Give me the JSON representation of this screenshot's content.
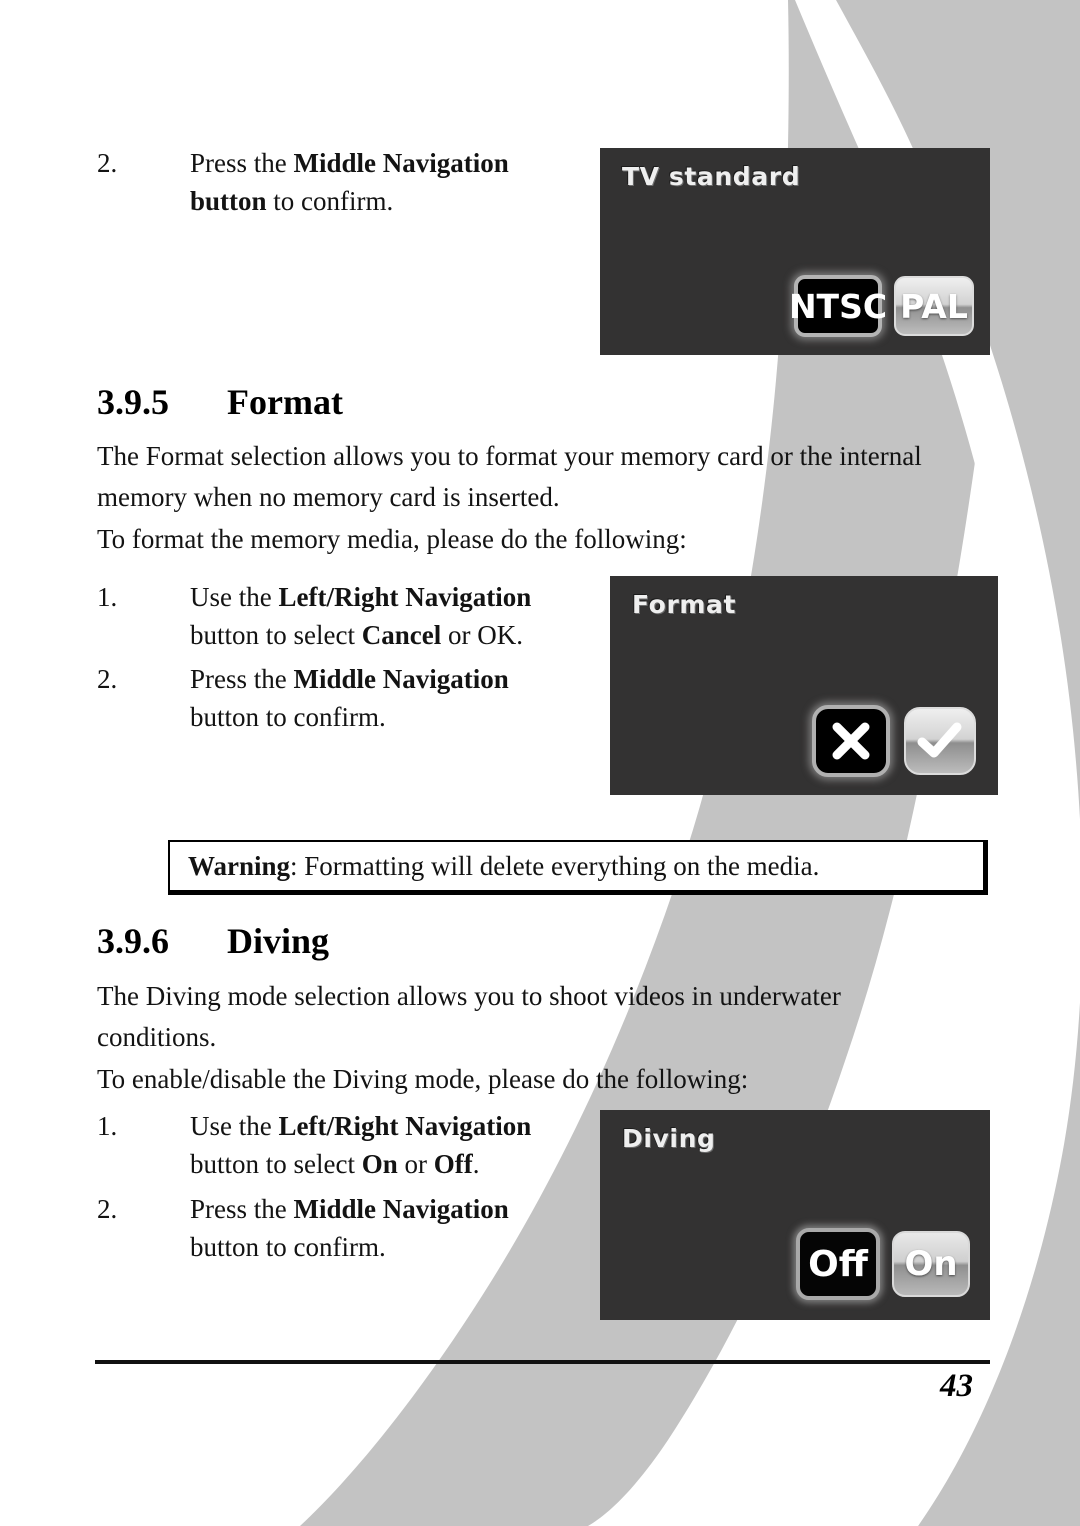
{
  "page": {
    "number": "43",
    "accent_gray": "#c3c3c3",
    "lcd_background": "#333232"
  },
  "top_step": {
    "number": "2.",
    "line1_pre": "Press the ",
    "line1_bold": "Middle Navigation",
    "line2_bold": "button",
    "line2_post": " to confirm."
  },
  "tv_standard_shot": {
    "title": "TV standard",
    "options": [
      {
        "label": "NTSC",
        "selected": true
      },
      {
        "label": "PAL",
        "selected": false
      }
    ]
  },
  "section_format": {
    "number": "3.9.5",
    "title": "Format",
    "paragraph1": "The Format selection allows you to format your memory card or the internal memory when no memory card is inserted.",
    "paragraph2": "To format the memory media, please do the following:",
    "steps": [
      {
        "number": "1.",
        "line1_pre": "Use the ",
        "line1_bold": "Left/Right Navigation",
        "line2_pre": "button to select ",
        "line2_bold": "Cancel",
        "line2_post": " or OK."
      },
      {
        "number": "2.",
        "line1_pre": "Press the ",
        "line1_bold": "Middle Navigation",
        "line2_pre": "button to confirm.",
        "line2_bold": "",
        "line2_post": ""
      }
    ],
    "warning": {
      "label": "Warning",
      "text": ": Formatting will delete everything on the media."
    },
    "shot": {
      "title": "Format",
      "options": [
        {
          "label": "Cancel",
          "icon": "cross-icon",
          "selected": true
        },
        {
          "label": "OK",
          "icon": "check-icon",
          "selected": false
        }
      ]
    }
  },
  "section_diving": {
    "number": "3.9.6",
    "title": "Diving",
    "paragraph1": "The Diving mode selection allows you to shoot videos in underwater conditions.",
    "paragraph2": "To enable/disable the Diving mode, please do the following:",
    "steps": [
      {
        "number": "1.",
        "line1_pre": "Use the ",
        "line1_bold": "Left/Right Navigation",
        "line2_pre": "button to select ",
        "line2_bold_a": "On",
        "line2_mid": " or ",
        "line2_bold_b": "Off",
        "line2_post": "."
      },
      {
        "number": "2.",
        "line1_pre": "Press the ",
        "line1_bold": "Middle Navigation",
        "line2_pre": "button to confirm."
      }
    ],
    "shot": {
      "title": "Diving",
      "options": [
        {
          "label": "Off",
          "selected": true
        },
        {
          "label": "On",
          "selected": false
        }
      ]
    }
  }
}
